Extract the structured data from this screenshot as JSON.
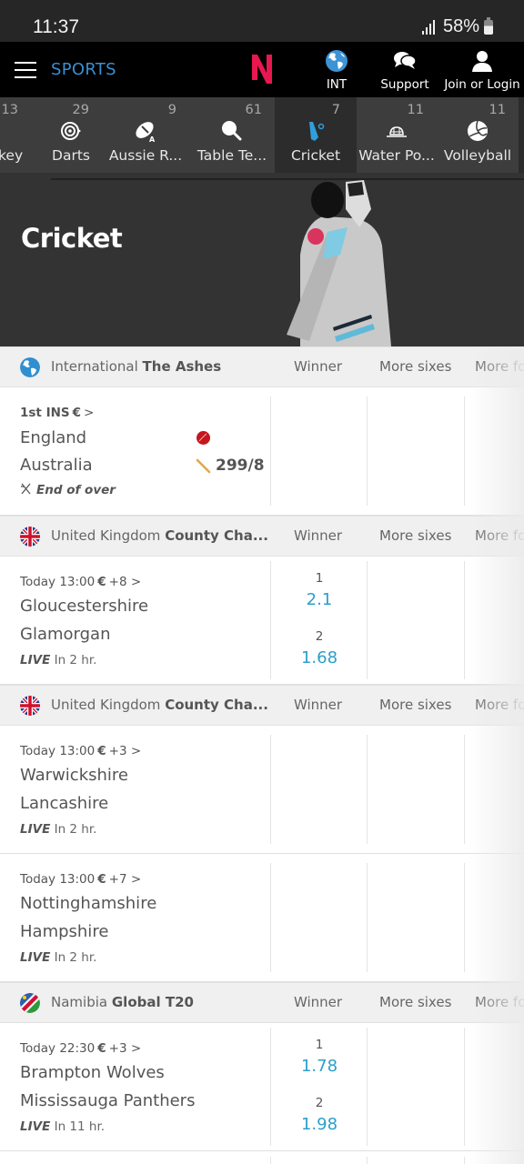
{
  "status_bar": {
    "time": "11:37",
    "battery": "58%"
  },
  "header": {
    "menu_label": "SPORTS",
    "logo_letter": "N",
    "region_label": "INT",
    "support_label": "Support",
    "login_label": "Join or Login"
  },
  "sport_tabs": [
    {
      "label": "key",
      "count": "13",
      "icon": "hockey-icon"
    },
    {
      "label": "Darts",
      "count": "29",
      "icon": "darts-icon"
    },
    {
      "label": "Aussie R...",
      "count": "9",
      "icon": "aussie-rules-icon"
    },
    {
      "label": "Table Te...",
      "count": "61",
      "icon": "table-tennis-icon"
    },
    {
      "label": "Cricket",
      "count": "7",
      "icon": "cricket-icon",
      "active": true
    },
    {
      "label": "Water Po...",
      "count": "11",
      "icon": "water-polo-icon"
    },
    {
      "label": "Volleyball",
      "count": "11",
      "icon": "volleyball-icon"
    }
  ],
  "hero": {
    "title": "Cricket"
  },
  "columns": {
    "winner": "Winner",
    "sixes": "More sixes",
    "fours": "More fo"
  },
  "sections": [
    {
      "region": "International",
      "league": "The Ashes",
      "flag": "globe",
      "events": [
        {
          "meta": "1st INS",
          "euro": "€",
          "more": ">",
          "team1": "England",
          "team2": "Australia",
          "team1_indicator": "bowling-ball",
          "team2_indicator": "batting",
          "score": "299/8",
          "status_prefix": "",
          "status": "End of over"
        }
      ]
    },
    {
      "region": "United Kingdom",
      "league": "County Cha...",
      "flag": "uk",
      "events": [
        {
          "meta": "Today 13:00",
          "euro": "€",
          "more": "+8 >",
          "team1": "Gloucestershire",
          "team2": "Glamorgan",
          "status_prefix": "LIVE",
          "status": "In 2 hr.",
          "odds": [
            {
              "label": "1",
              "value": "2.1"
            },
            {
              "label": "2",
              "value": "1.68"
            }
          ]
        }
      ]
    },
    {
      "region": "United Kingdom",
      "league": "County Cha...",
      "flag": "uk",
      "events": [
        {
          "meta": "Today 13:00",
          "euro": "€",
          "more": "+3 >",
          "team1": "Warwickshire",
          "team2": "Lancashire",
          "status_prefix": "LIVE",
          "status": "In 2 hr."
        },
        {
          "meta": "Today 13:00",
          "euro": "€",
          "more": "+7 >",
          "team1": "Nottinghamshire",
          "team2": "Hampshire",
          "status_prefix": "LIVE",
          "status": "In 2 hr."
        }
      ]
    },
    {
      "region": "Namibia",
      "league": "Global T20",
      "flag": "namibia",
      "events": [
        {
          "meta": "Today 22:30",
          "euro": "€",
          "more": "+3 >",
          "team1": "Brampton Wolves",
          "team2": "Mississauga Panthers",
          "status_prefix": "LIVE",
          "status": "In 11 hr.",
          "odds": [
            {
              "label": "1",
              "value": "1.78"
            },
            {
              "label": "2",
              "value": "1.98"
            }
          ]
        }
      ]
    }
  ],
  "colors": {
    "accent": "#2b9fc9",
    "sports_blue": "#3a8fd1",
    "logo_red": "#e8174f"
  }
}
